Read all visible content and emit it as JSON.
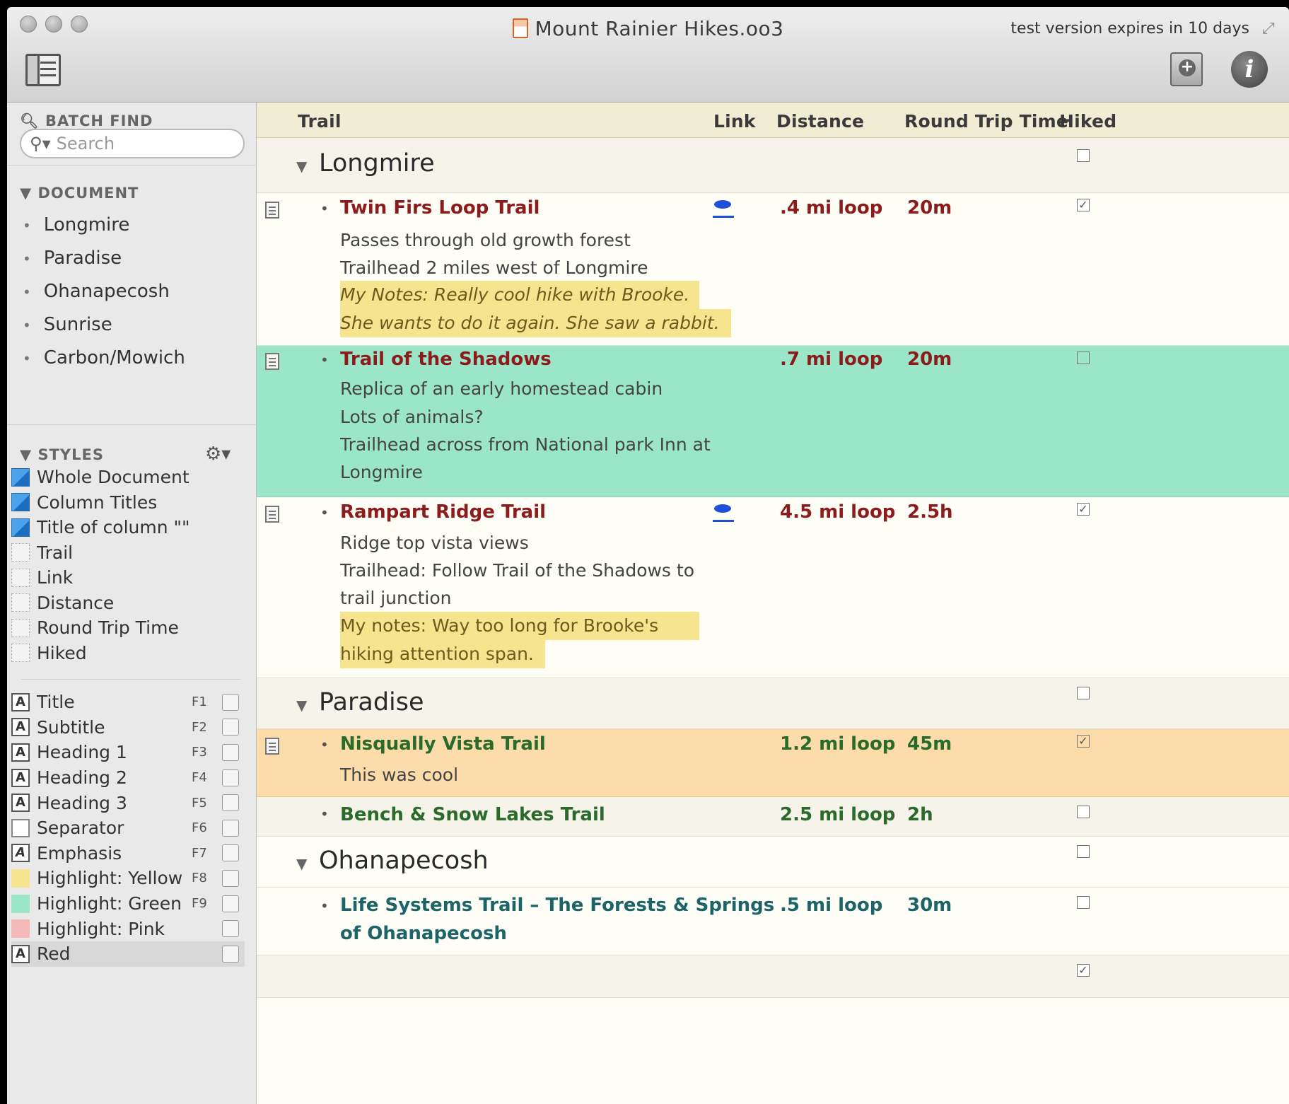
{
  "window": {
    "title": "Mount Rainier Hikes.oo3",
    "expiry_notice": "test version expires in 10 days"
  },
  "sidebar": {
    "batch_find_label": "BATCH FIND",
    "search_placeholder": "Search",
    "document_label": "DOCUMENT",
    "document_items": [
      "Longmire",
      "Paradise",
      "Ohanapecosh",
      "Sunrise",
      "Carbon/Mowich"
    ],
    "styles_label": "STYLES",
    "style_items": [
      "Whole Document",
      "Column Titles",
      "Title of column \"\"",
      "Trail",
      "Link",
      "Distance",
      "Round Trip Time",
      "Hiked"
    ],
    "named_styles": [
      {
        "label": "Title",
        "key": "F1",
        "swatch": "A"
      },
      {
        "label": "Subtitle",
        "key": "F2",
        "swatch": "A"
      },
      {
        "label": "Heading 1",
        "key": "F3",
        "swatch": "A"
      },
      {
        "label": "Heading 2",
        "key": "F4",
        "swatch": "A"
      },
      {
        "label": "Heading 3",
        "key": "F5",
        "swatch": "A"
      },
      {
        "label": "Separator",
        "key": "F6",
        "swatch": ""
      },
      {
        "label": "Emphasis",
        "key": "F7",
        "swatch": "A"
      },
      {
        "label": "Highlight: Yellow",
        "key": "F8",
        "swatch": "",
        "color": "#f6e58e"
      },
      {
        "label": "Highlight: Green",
        "key": "F9",
        "swatch": "",
        "color": "#9be6c9"
      },
      {
        "label": "Highlight: Pink",
        "key": "",
        "swatch": "",
        "color": "#f4b9b9"
      },
      {
        "label": "Red",
        "key": "",
        "swatch": "A"
      }
    ]
  },
  "columns": {
    "trail": "Trail",
    "link": "Link",
    "distance": "Distance",
    "round_trip_time": "Round Trip Time",
    "hiked": "Hiked"
  },
  "groups": {
    "longmire": "Longmire",
    "paradise": "Paradise",
    "ohanapecosh": "Ohanapecosh"
  },
  "trails": {
    "twin_firs": {
      "name": "Twin Firs Loop Trail",
      "distance": ".4 mi loop",
      "time": "20m",
      "notes": [
        "Passes through old growth forest",
        "Trailhead 2 miles west of Longmire"
      ],
      "highlight": [
        "My Notes: Really cool hike with Brooke.",
        "She wants to do it again. She saw a rabbit."
      ],
      "hiked": true
    },
    "shadows": {
      "name": "Trail of the Shadows",
      "distance": ".7 mi loop",
      "time": "20m",
      "notes": [
        "Replica of an early homestead cabin",
        "Lots of animals?",
        "Trailhead across from National park Inn at",
        "Longmire"
      ],
      "hiked": false
    },
    "rampart": {
      "name": "Rampart Ridge Trail",
      "distance": "4.5 mi loop",
      "time": "2.5h",
      "notes": [
        "Ridge top vista views",
        "Trailhead: Follow Trail of the Shadows to",
        "trail junction"
      ],
      "highlight": [
        "My notes: Way too long for Brooke's",
        "hiking attention span."
      ],
      "hiked": true
    },
    "nisqually": {
      "name": "Nisqually Vista Trail",
      "distance": "1.2 mi loop",
      "time": "45m",
      "notes": [
        "This was cool"
      ],
      "hiked": true
    },
    "bench": {
      "name": "Bench & Snow Lakes Trail",
      "distance": "2.5 mi loop",
      "time": "2h",
      "hiked": false
    },
    "life_systems": {
      "name_line1": "Life Systems Trail – The Forests & Springs",
      "name_line2": "of Ohanapecosh",
      "distance": ".5 mi loop",
      "time": "30m",
      "hiked": false
    }
  },
  "colors": {
    "green_highlight": "#9be6c9",
    "orange_highlight": "#fbdcaa",
    "yellow_highlight": "#f6e58e",
    "header_bg": "#f1ecd4"
  }
}
